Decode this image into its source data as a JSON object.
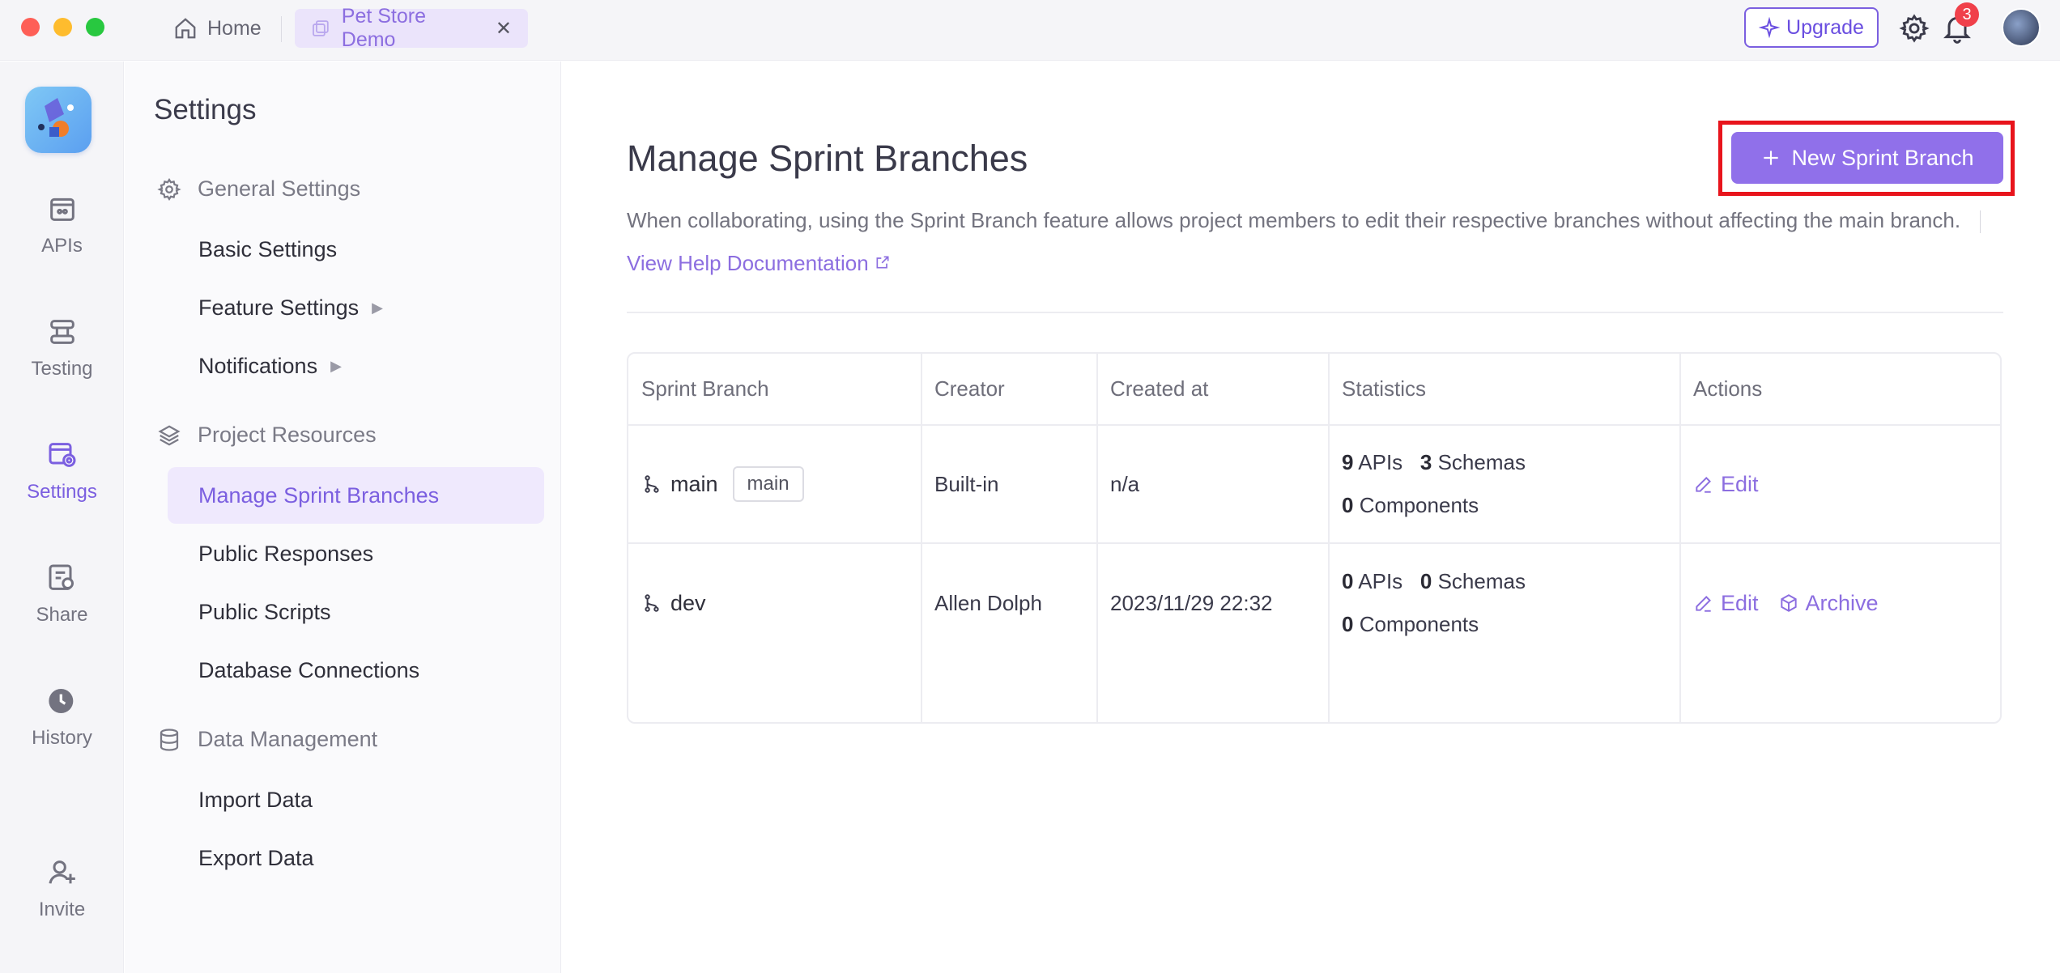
{
  "topbar": {
    "home_label": "Home",
    "project_tab": "Pet Store Demo",
    "upgrade_label": "Upgrade",
    "notification_count": "3"
  },
  "rail": {
    "items": [
      {
        "label": "APIs",
        "icon": "apis-icon"
      },
      {
        "label": "Testing",
        "icon": "testing-icon"
      },
      {
        "label": "Settings",
        "icon": "settings-icon"
      },
      {
        "label": "Share",
        "icon": "share-icon"
      },
      {
        "label": "History",
        "icon": "history-icon"
      },
      {
        "label": "Invite",
        "icon": "invite-icon"
      }
    ]
  },
  "sidebar": {
    "title": "Settings",
    "groups": [
      {
        "label": "General Settings",
        "items": [
          "Basic Settings",
          "Feature Settings",
          "Notifications"
        ]
      },
      {
        "label": "Project Resources",
        "items": [
          "Manage Sprint Branches",
          "Public Responses",
          "Public Scripts",
          "Database Connections"
        ]
      },
      {
        "label": "Data Management",
        "items": [
          "Import Data",
          "Export Data"
        ]
      }
    ]
  },
  "main": {
    "title": "Manage Sprint Branches",
    "new_button": "New Sprint Branch",
    "description": "When collaborating, using the Sprint Branch feature allows project members to edit their respective branches without affecting the main branch.",
    "help_link": "View Help Documentation",
    "table": {
      "headers": [
        "Sprint Branch",
        "Creator",
        "Created at",
        "Statistics",
        "Actions"
      ],
      "rows": [
        {
          "branch": "main",
          "tag": "main",
          "creator": "Built-in",
          "created_at": "n/a",
          "apis": "9",
          "apis_label": "APIs",
          "schemas": "3",
          "schemas_label": "Schemas",
          "components": "0",
          "components_label": "Components",
          "edit_label": "Edit"
        },
        {
          "branch": "dev",
          "creator": "Allen Dolph",
          "created_at": "2023/11/29 22:32",
          "apis": "0",
          "apis_label": "APIs",
          "schemas": "0",
          "schemas_label": "Schemas",
          "components": "0",
          "components_label": "Components",
          "edit_label": "Edit",
          "archive_label": "Archive"
        }
      ]
    }
  },
  "colors": {
    "accent": "#9070ea",
    "highlight": "#e8141c",
    "badge": "#f0404a"
  }
}
